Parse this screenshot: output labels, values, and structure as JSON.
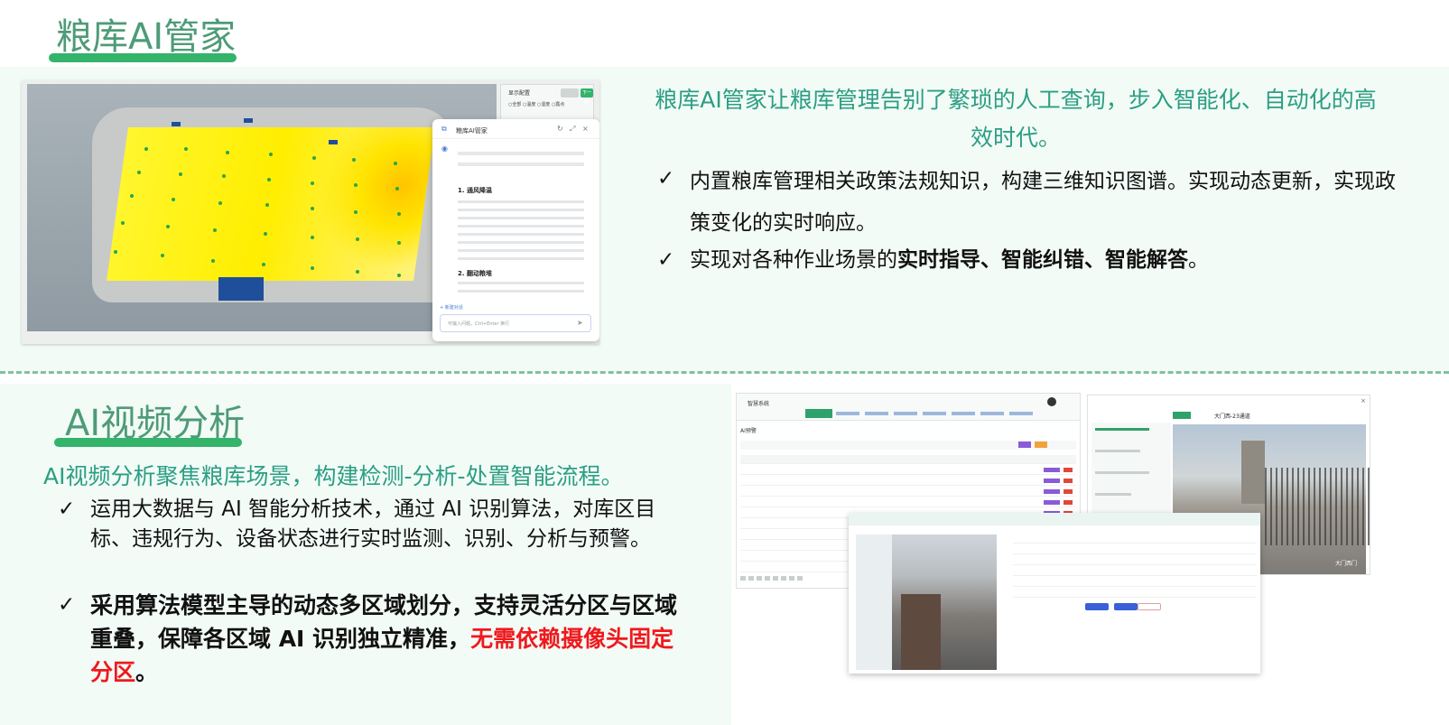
{
  "section1": {
    "title": "粮库AI管家",
    "intro": "粮库AI管家让粮库管理告别了繁琐的人工查询，步入智能化、自动化的高效时代。",
    "bullets": [
      {
        "check": "✓",
        "text": "内置粮库管理相关政策法规知识，构建三维知识图谱。实现动态更新，实现政策变化的实时响应。"
      },
      {
        "check": "✓",
        "text_before": "实现对各种作业场景的",
        "text_bold": "实时指导、智能纠错、智能解答",
        "text_after": "。"
      }
    ],
    "screenshot": {
      "chat_title": "粮库AI管家",
      "chat_section1": "1. 通风降温",
      "chat_section2": "2. 翻动粮堆",
      "new_chat": "+ 新建对话",
      "input_placeholder": "可输入问题，Ctrl+Enter 换行",
      "config_title": "显示配置",
      "config_btn2": "下一帧",
      "config_opts": "○全部  ○温度  ○湿度  ○露点"
    }
  },
  "section2": {
    "title": "AI视频分析",
    "intro": "AI视频分析聚焦粮库场景，构建检测-分析-处置智能流程。",
    "bullets": [
      {
        "check": "✓",
        "text": "运用大数据与 AI 智能分析技术，通过 AI 识别算法，对库区目标、违规行为、设备状态进行实时监测、识别、分析与预警。"
      },
      {
        "check": "✓",
        "text_before": "采用算法模型主导的动态多区域划分，支持灵活分区与区域重叠，保障各区域 AI 识别独立精准，",
        "text_red": "无需依赖摄像头固定分区",
        "text_after": "。"
      }
    ],
    "screenshots": {
      "a_system": "智慧系统",
      "a_panel": "AI预警",
      "b_gate": "大门西-23通道",
      "b_caption": "大门西门"
    }
  },
  "colors": {
    "accent_green": "#34b36a",
    "title_green": "#4e9b78",
    "intro_teal": "#2c9e84",
    "highlight_red": "#f0191d",
    "band_bg": "#f2fbf6"
  },
  "icons": [
    "check-icon",
    "ai-assistant-icon",
    "history-icon",
    "expand-icon",
    "close-icon",
    "send-icon"
  ]
}
